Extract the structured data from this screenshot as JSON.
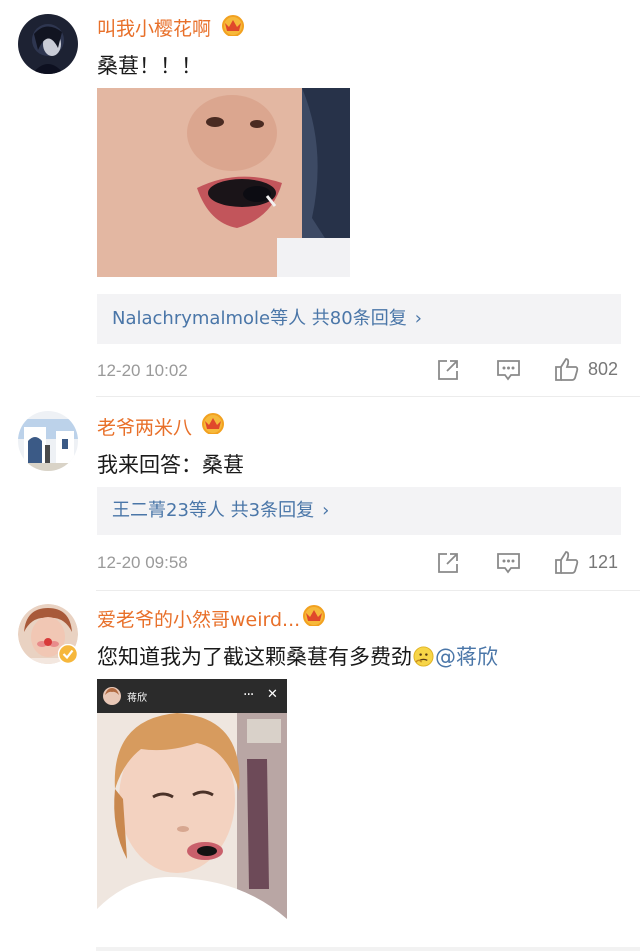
{
  "comments": [
    {
      "username": "叫我小樱花啊",
      "text": "桑葚！！！",
      "reply_summary": "Nalachrymalmole等人  共80条回复",
      "reply_chevron": "›",
      "time": "12-20 10:02",
      "likes": "802",
      "icons": [
        "vip-crown-icon",
        "share-icon",
        "comment-icon",
        "thumbs-up-icon"
      ]
    },
    {
      "username": "老爷两米八",
      "text": "我来回答：桑葚",
      "reply_summary": "王二菁23等人  共3条回复",
      "reply_chevron": "›",
      "time": "12-20 09:58",
      "likes": "121",
      "icons": [
        "vip-crown-icon",
        "share-icon",
        "comment-icon",
        "thumbs-up-icon"
      ]
    },
    {
      "username": "爱老爷的小然哥weird...",
      "text_main": "您知道我为了截这颗桑葚有多费劲",
      "text_mention": "@蒋欣",
      "inline_emoji": "thinking-emoji",
      "icons": [
        "vip-crown-icon",
        "verified-badge-icon"
      ],
      "video": {
        "author_name": "蒋欣",
        "more_label": "···",
        "close_label": "✕"
      }
    }
  ],
  "colors": {
    "username": "#e8702a",
    "link": "#4a76a8",
    "reply_bg": "#f3f3f5",
    "meta": "#9a9a9a"
  }
}
